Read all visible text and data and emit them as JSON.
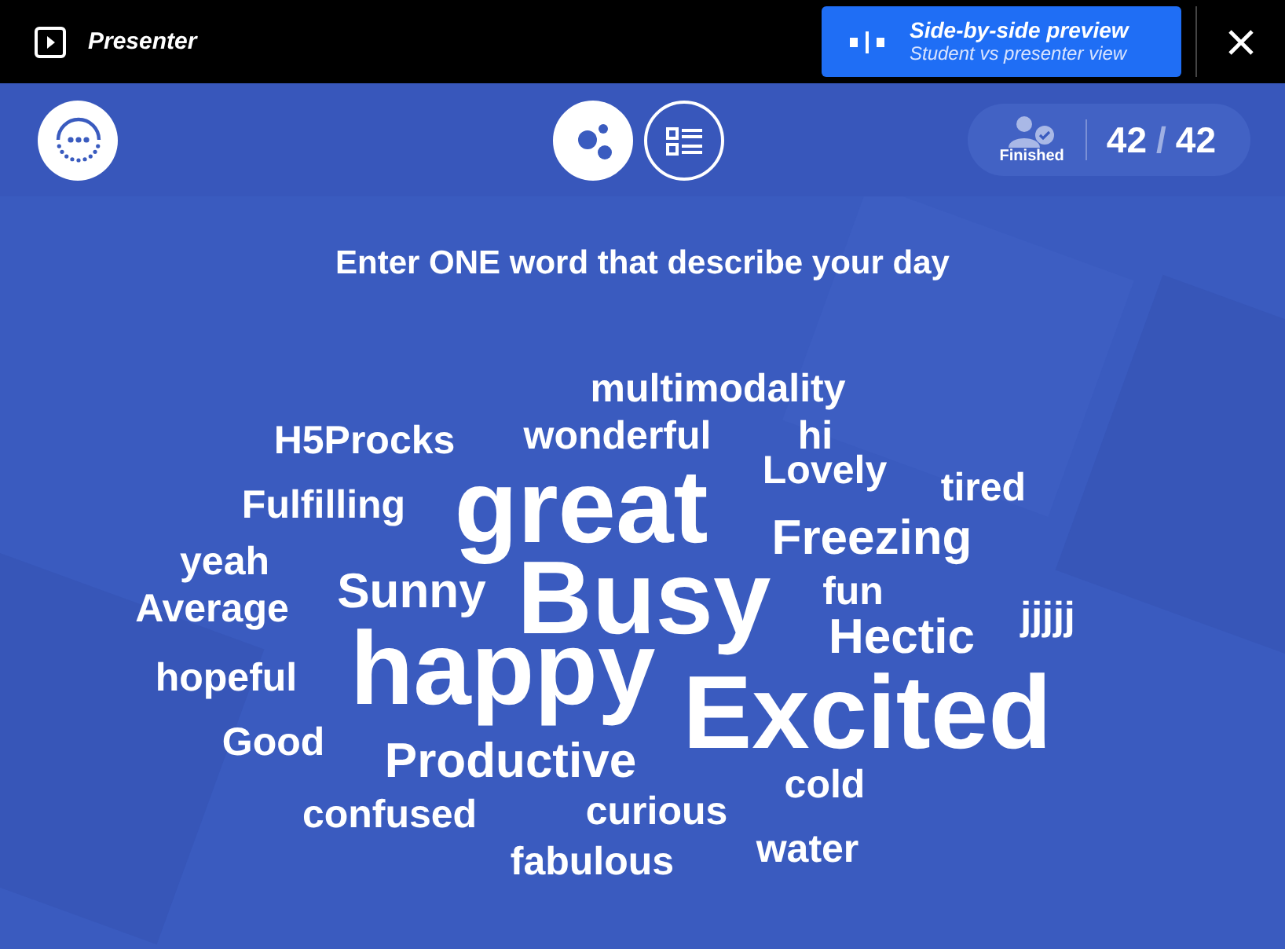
{
  "topbar": {
    "title": "Presenter",
    "preview_button": {
      "title": "Side-by-side preview",
      "subtitle": "Student vs presenter view"
    }
  },
  "toolbar": {
    "views": [
      {
        "kind": "cloud",
        "selected": true
      },
      {
        "kind": "list",
        "selected": false
      }
    ],
    "status": {
      "label": "Finished",
      "count": "42",
      "separator": "/",
      "total": "42"
    }
  },
  "question": "Enter ONE word that describe your day",
  "words": [
    {
      "text": "multimodality",
      "kind": "small"
    },
    {
      "text": "H5Procks",
      "kind": "small"
    },
    {
      "text": "wonderful",
      "kind": "small"
    },
    {
      "text": "hi",
      "kind": "small"
    },
    {
      "text": "Fulfilling",
      "kind": "small"
    },
    {
      "text": "great",
      "kind": "large"
    },
    {
      "text": "Lovely",
      "kind": "small"
    },
    {
      "text": "tired",
      "kind": "small"
    },
    {
      "text": "yeah",
      "kind": "small"
    },
    {
      "text": "Freezing",
      "kind": "medium"
    },
    {
      "text": "Average",
      "kind": "small"
    },
    {
      "text": "Sunny",
      "kind": "medium"
    },
    {
      "text": "Busy",
      "kind": "large"
    },
    {
      "text": "fun",
      "kind": "small"
    },
    {
      "text": "jjjjj",
      "kind": "small"
    },
    {
      "text": "Hectic",
      "kind": "medium"
    },
    {
      "text": "hopeful",
      "kind": "small"
    },
    {
      "text": "happy",
      "kind": "large"
    },
    {
      "text": "Good",
      "kind": "small"
    },
    {
      "text": "Productive",
      "kind": "medium"
    },
    {
      "text": "Excited",
      "kind": "large"
    },
    {
      "text": "confused",
      "kind": "small"
    },
    {
      "text": "curious",
      "kind": "small"
    },
    {
      "text": "cold",
      "kind": "small"
    },
    {
      "text": "fabulous",
      "kind": "small"
    },
    {
      "text": "water",
      "kind": "small"
    }
  ]
}
